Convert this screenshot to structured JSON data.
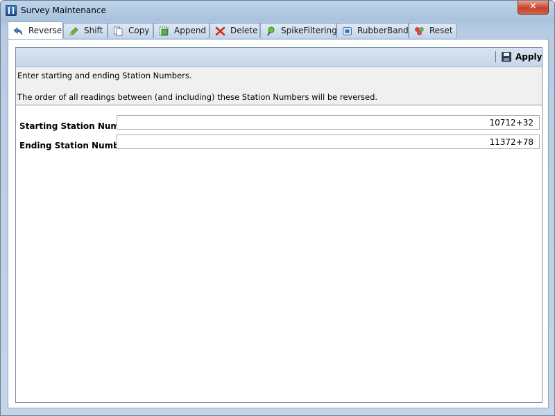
{
  "window": {
    "title": "Survey Maintenance",
    "close_glyph": "✕"
  },
  "tabs": [
    {
      "label": "Reverse",
      "icon": "reverse-arrow-icon",
      "active": true
    },
    {
      "label": "Shift",
      "icon": "shift-pencil-icon"
    },
    {
      "label": "Copy",
      "icon": "copy-icon"
    },
    {
      "label": "Append",
      "icon": "append-icon"
    },
    {
      "label": "Delete",
      "icon": "delete-x-icon"
    },
    {
      "label": "SpikeFiltering",
      "icon": "spike-filter-icon"
    },
    {
      "label": "RubberBand",
      "icon": "rubberband-icon"
    },
    {
      "label": "Reset",
      "icon": "reset-icon"
    }
  ],
  "toolbar": {
    "apply_label": "Apply",
    "apply_icon": "save-disk-icon"
  },
  "instructions": {
    "line1": "Enter starting and ending Station Numbers.",
    "line2": "The order of all readings between (and including) these Station Numbers will be reversed."
  },
  "form": {
    "starting_label": "Starting Station Number",
    "starting_value": "10712+32",
    "ending_label": "Ending Station Number",
    "ending_value": "11372+78"
  }
}
